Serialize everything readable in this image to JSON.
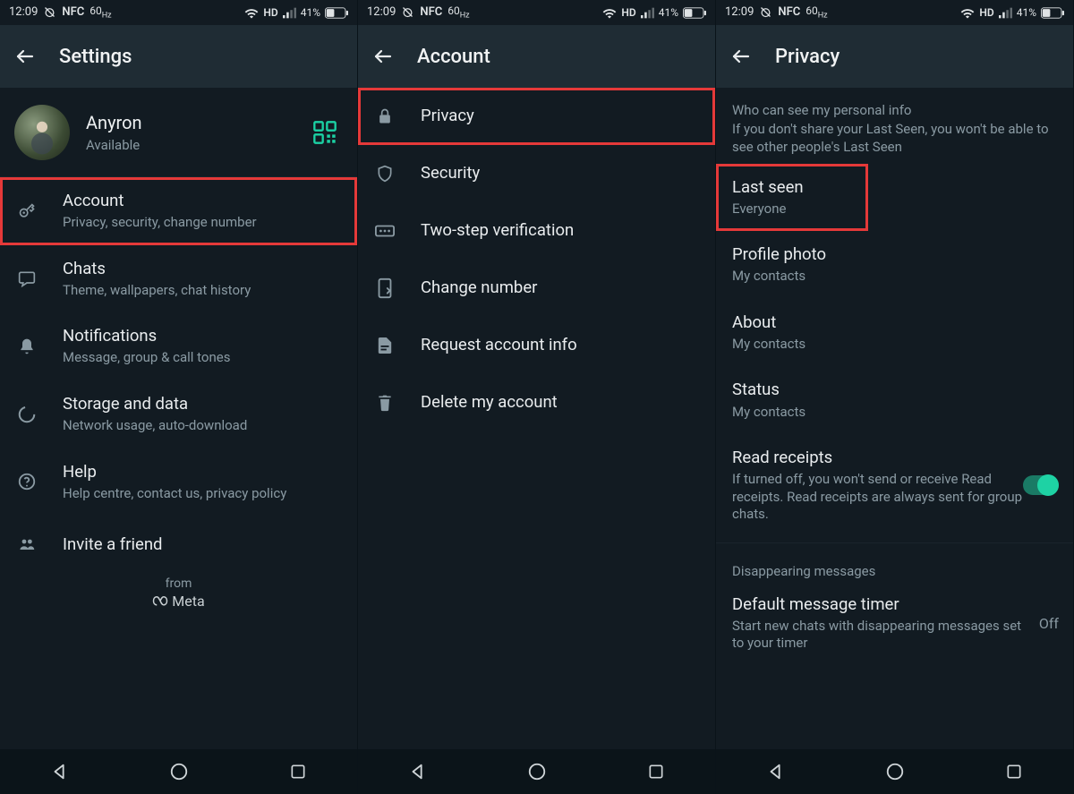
{
  "status": {
    "time": "12:09",
    "nfc": "NFC",
    "hz": "60",
    "hzunit": "Hz",
    "hd": "HD",
    "battery": "41%"
  },
  "panel1": {
    "title": "Settings",
    "profile": {
      "name": "Anyron",
      "status": "Available"
    },
    "items": {
      "account": {
        "title": "Account",
        "sub": "Privacy, security, change number"
      },
      "chats": {
        "title": "Chats",
        "sub": "Theme, wallpapers, chat history"
      },
      "notifications": {
        "title": "Notifications",
        "sub": "Message, group & call tones"
      },
      "storage": {
        "title": "Storage and data",
        "sub": "Network usage, auto-download"
      },
      "help": {
        "title": "Help",
        "sub": "Help centre, contact us, privacy policy"
      },
      "invite": {
        "title": "Invite a friend"
      }
    },
    "from": "from",
    "meta": "Meta"
  },
  "panel2": {
    "title": "Account",
    "items": {
      "privacy": {
        "title": "Privacy"
      },
      "security": {
        "title": "Security"
      },
      "twostep": {
        "title": "Two-step verification"
      },
      "changenum": {
        "title": "Change number"
      },
      "request": {
        "title": "Request account info"
      },
      "delete": {
        "title": "Delete my account"
      }
    }
  },
  "panel3": {
    "title": "Privacy",
    "sectionHeader": "Who can see my personal info",
    "sectionSub": "If you don't share your Last Seen, you won't be able to see other people's Last Seen",
    "items": {
      "lastseen": {
        "title": "Last seen",
        "sub": "Everyone"
      },
      "profilephoto": {
        "title": "Profile photo",
        "sub": "My contacts"
      },
      "about": {
        "title": "About",
        "sub": "My contacts"
      },
      "status": {
        "title": "Status",
        "sub": "My contacts"
      },
      "readreceipts": {
        "title": "Read receipts",
        "sub": "If turned off, you won't send or receive Read receipts. Read receipts are always sent for group chats."
      },
      "disappearingHeader": "Disappearing messages",
      "defaulttimer": {
        "title": "Default message timer",
        "sub": "Start new chats with disappearing messages set to your timer",
        "value": "Off"
      }
    }
  }
}
